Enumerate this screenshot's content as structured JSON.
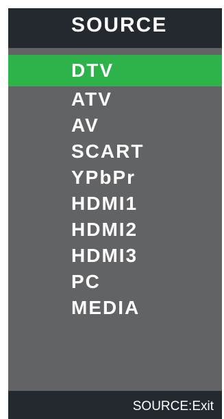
{
  "header": {
    "title": "SOURCE"
  },
  "sources": [
    {
      "label": "DTV",
      "selected": true
    },
    {
      "label": "ATV",
      "selected": false
    },
    {
      "label": "AV",
      "selected": false
    },
    {
      "label": "SCART",
      "selected": false
    },
    {
      "label": "YPbPr",
      "selected": false
    },
    {
      "label": "HDMI1",
      "selected": false
    },
    {
      "label": "HDMI2",
      "selected": false
    },
    {
      "label": "HDMI3",
      "selected": false
    },
    {
      "label": "PC",
      "selected": false
    },
    {
      "label": "MEDIA",
      "selected": false
    }
  ],
  "footer": {
    "hint": "SOURCE:Exit"
  },
  "colors": {
    "panel": "#626365",
    "header": "#24292f",
    "highlight": "#2db34a",
    "text": "#ffffff"
  }
}
